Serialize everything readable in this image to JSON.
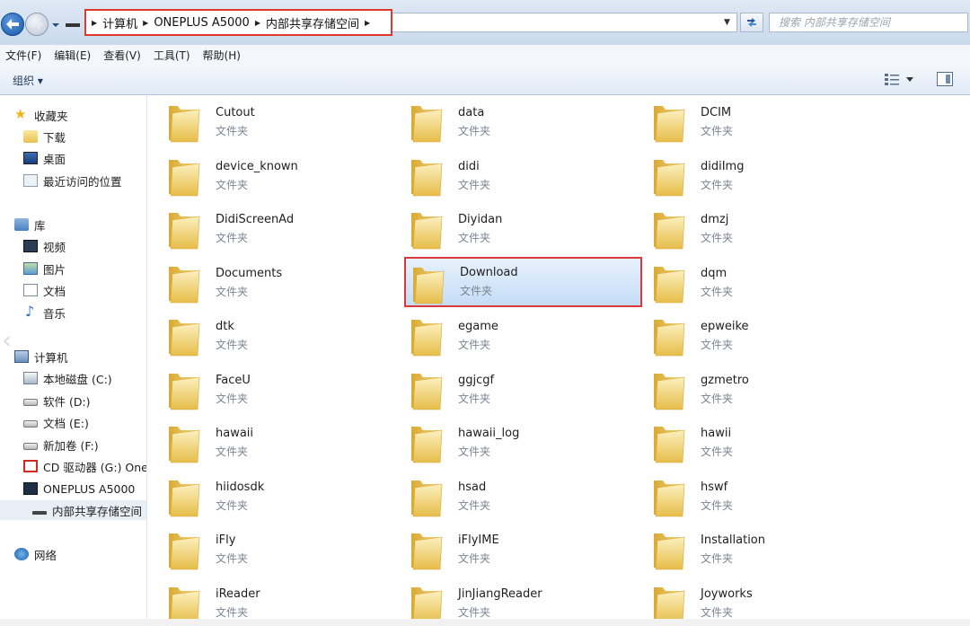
{
  "address": {
    "crumbs": [
      "计算机",
      "ONEPLUS A5000",
      "内部共享存储空间"
    ],
    "search_placeholder": "搜索 内部共享存储空间"
  },
  "menubar": {
    "items": [
      "文件(F)",
      "编辑(E)",
      "查看(V)",
      "工具(T)",
      "帮助(H)"
    ]
  },
  "toolbar": {
    "organize_label": "组织 ▾"
  },
  "nav": {
    "favorites": "收藏夹",
    "downloads": "下载",
    "desktop": "桌面",
    "recent": "最近访问的位置",
    "libraries": "库",
    "videos": "视频",
    "pictures": "图片",
    "documents": "文档",
    "music": "音乐",
    "computer": "计算机",
    "drive_c": "本地磁盘 (C:)",
    "drive_d": "软件 (D:)",
    "drive_e": "文档 (E:)",
    "drive_f": "新加卷 (F:)",
    "drive_g": "CD 驱动器 (G:) One",
    "device": "ONEPLUS A5000",
    "storage": "内部共享存储空间",
    "network": "网络"
  },
  "folders": {
    "type_label": "文件夹",
    "names": [
      "Cutout",
      "data",
      "DCIM",
      "device_known",
      "didi",
      "didiImg",
      "DidiScreenAd",
      "Diyidan",
      "dmzj",
      "Documents",
      "Download",
      "dqm",
      "dtk",
      "egame",
      "epweike",
      "FaceU",
      "ggjcgf",
      "gzmetro",
      "hawaii",
      "hawaii_log",
      "hawii",
      "hiidosdk",
      "hsad",
      "hswf",
      "iFly",
      "iFlyIME",
      "Installation",
      "iReader",
      "JinJiangReader",
      "Joyworks"
    ],
    "selected": "Download"
  },
  "colors": {
    "highlight_border": "#e0392c",
    "selection_fill": "#c5dcf6"
  }
}
